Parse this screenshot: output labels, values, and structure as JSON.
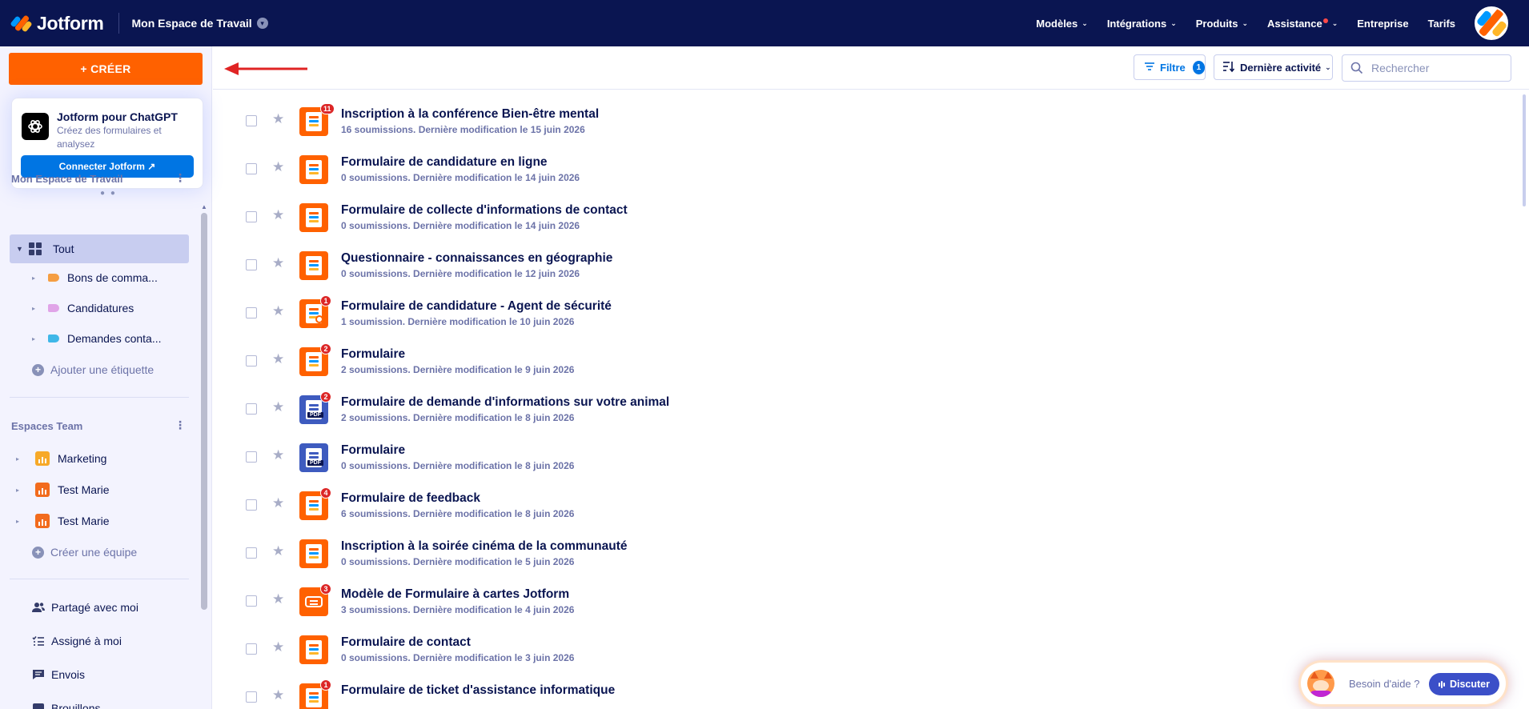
{
  "topbar": {
    "brand": "Jotform",
    "workspace": "Mon Espace de Travail",
    "nav": [
      {
        "label": "Modèles",
        "chevron": true
      },
      {
        "label": "Intégrations",
        "chevron": true
      },
      {
        "label": "Produits",
        "chevron": true
      },
      {
        "label": "Assistance",
        "chevron": true,
        "dot": true
      },
      {
        "label": "Entreprise",
        "chevron": false
      },
      {
        "label": "Tarifs",
        "chevron": false
      }
    ]
  },
  "sidebar": {
    "create_label": "+ CRÉER",
    "gpt": {
      "title": "Jotform pour ChatGPT",
      "description": "Créez des formulaires et analysez",
      "button": "Connecter Jotform ↗"
    },
    "workspace_section": "Mon Espace de Travail",
    "all_label": "Tout",
    "labels": [
      {
        "label": "Bons de comma...",
        "color": "#f59e42"
      },
      {
        "label": "Candidatures",
        "color": "#e0a4e8"
      },
      {
        "label": "Demandes conta...",
        "color": "#3fb7e8"
      }
    ],
    "add_label": "Ajouter une étiquette",
    "teams_section": "Espaces Team",
    "teams": [
      {
        "label": "Marketing",
        "color": "#f7a928"
      },
      {
        "label": "Test Marie",
        "color": "#f26b1d"
      },
      {
        "label": "Test Marie",
        "color": "#f26b1d"
      }
    ],
    "create_team": "Créer une équipe",
    "bottom": [
      {
        "label": "Partagé avec moi",
        "icon": "shared-users-icon"
      },
      {
        "label": "Assigné à moi",
        "icon": "assigned-list-icon"
      },
      {
        "label": "Envois",
        "icon": "message-icon"
      },
      {
        "label": "Brouillons",
        "icon": "drafts-icon"
      }
    ]
  },
  "toolbar": {
    "filter_label": "Filtre",
    "filter_count": "1",
    "sort_label": "Dernière activité",
    "search_placeholder": "Rechercher"
  },
  "forms": [
    {
      "title": "Inscription à la conférence Bien-être mental",
      "meta": "16 soumissions. Dernière modification le 15 juin 2026",
      "icon": "orange",
      "badge": "11"
    },
    {
      "title": "Formulaire de candidature en ligne",
      "meta": "0 soumissions. Dernière modification le 14 juin 2026",
      "icon": "orange",
      "badge": ""
    },
    {
      "title": "Formulaire de collecte d'informations de contact",
      "meta": "0 soumissions. Dernière modification le 14 juin 2026",
      "icon": "orange",
      "badge": ""
    },
    {
      "title": "Questionnaire - connaissances en géographie",
      "meta": "0 soumissions. Dernière modification le 12 juin 2026",
      "icon": "orange",
      "badge": ""
    },
    {
      "title": "Formulaire de candidature - Agent de sécurité",
      "meta": "1 soumission. Dernière modification le 10 juin 2026",
      "icon": "orange-sign",
      "badge": "1"
    },
    {
      "title": "Formulaire",
      "meta": "2 soumissions. Dernière modification le 9 juin 2026",
      "icon": "orange",
      "badge": "2"
    },
    {
      "title": "Formulaire de demande d'informations sur votre animal",
      "meta": "2 soumissions. Dernière modification le 8 juin 2026",
      "icon": "pdf",
      "badge": "2"
    },
    {
      "title": "Formulaire",
      "meta": "0 soumissions. Dernière modification le 8 juin 2026",
      "icon": "pdf",
      "badge": ""
    },
    {
      "title": "Formulaire de feedback",
      "meta": "6 soumissions. Dernière modification le 8 juin 2026",
      "icon": "orange",
      "badge": "4"
    },
    {
      "title": "Inscription à la soirée cinéma de la communauté",
      "meta": "0 soumissions. Dernière modification le 5 juin 2026",
      "icon": "orange",
      "badge": ""
    },
    {
      "title": "Modèle de Formulaire à cartes Jotform",
      "meta": "3 soumissions. Dernière modification le 4 juin 2026",
      "icon": "orange-card",
      "badge": "3"
    },
    {
      "title": "Formulaire de contact",
      "meta": "0 soumissions. Dernière modification le 3 juin 2026",
      "icon": "orange",
      "badge": ""
    },
    {
      "title": "Formulaire de ticket d'assistance informatique",
      "meta": "",
      "icon": "orange",
      "badge": "1"
    }
  ],
  "help": {
    "text": "Besoin d'aide ?",
    "button": "Discuter"
  },
  "colors": {
    "navy": "#0a1551",
    "orange": "#ff6100",
    "blue": "#0075e3",
    "sidebar_bg": "#f3f3fe"
  }
}
